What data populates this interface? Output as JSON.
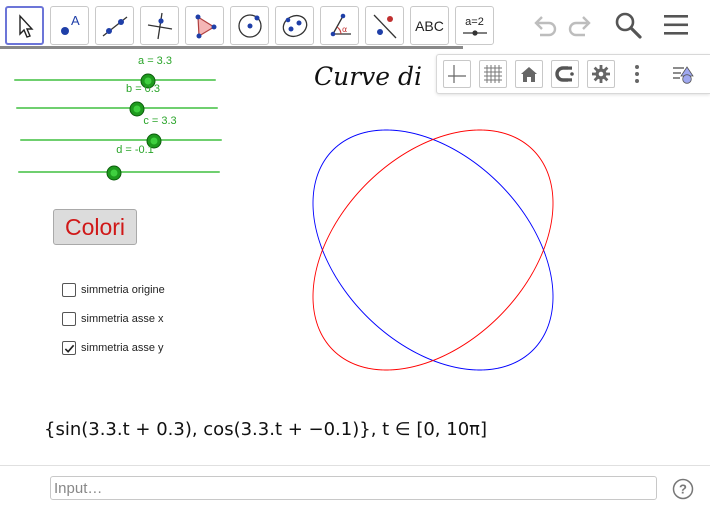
{
  "toolbar": {
    "tools": [
      {
        "name": "move-tool",
        "icon": "pointer-arrow-icon"
      },
      {
        "name": "point-tool",
        "icon": "point-with-label-icon"
      },
      {
        "name": "line-tool",
        "icon": "line-through-two-points-icon"
      },
      {
        "name": "perpendicular-line-tool",
        "icon": "perpendicular-line-icon"
      },
      {
        "name": "polygon-tool",
        "icon": "polygon-icon"
      },
      {
        "name": "circle-tool",
        "icon": "circle-with-center-icon"
      },
      {
        "name": "ellipse-tool",
        "icon": "ellipse-icon"
      },
      {
        "name": "angle-tool",
        "icon": "angle-icon"
      },
      {
        "name": "reflect-tool",
        "icon": "reflect-about-line-icon"
      },
      {
        "name": "text-tool",
        "label": "ABC"
      },
      {
        "name": "slider-tool",
        "label": "a=2"
      }
    ],
    "undo_icon": "undo-icon",
    "redo_icon": "redo-icon",
    "search_icon": "search-icon",
    "menu_icon": "hamburger-menu-icon"
  },
  "stylebar": {
    "items": [
      "axes-toggle-icon",
      "grid-toggle-icon",
      "home-icon",
      "snapping-icon",
      "gear-icon",
      "more-vertical-icon",
      "toggle-style-bar-icon"
    ]
  },
  "graphics": {
    "title": "Curve di",
    "sliders": [
      {
        "label": "a = 3.3",
        "value": 3.3
      },
      {
        "label": "b = 0.3",
        "value": 0.3
      },
      {
        "label": "c = 3.3",
        "value": 3.3
      },
      {
        "label": "d = -0.1",
        "value": -0.1
      }
    ],
    "colori_button": "Colori",
    "checkboxes": [
      {
        "label": "simmetria origine",
        "checked": false
      },
      {
        "label": "simmetria asse x",
        "checked": false
      },
      {
        "label": "simmetria asse y",
        "checked": true
      }
    ],
    "formula": "{sin(3.3.t + 0.3), cos(3.3.t + −0.1)},  t ∈ [0, 10π]"
  },
  "curve": {
    "primary_color": "#ff0000",
    "mirror_color": "#0000ff",
    "a": 3.3,
    "b": 0.3,
    "c": 3.3,
    "d": -0.1,
    "t_range": [
      0,
      31.4159
    ]
  },
  "input_bar": {
    "placeholder": "Input…",
    "help_icon": "help-question-icon"
  }
}
